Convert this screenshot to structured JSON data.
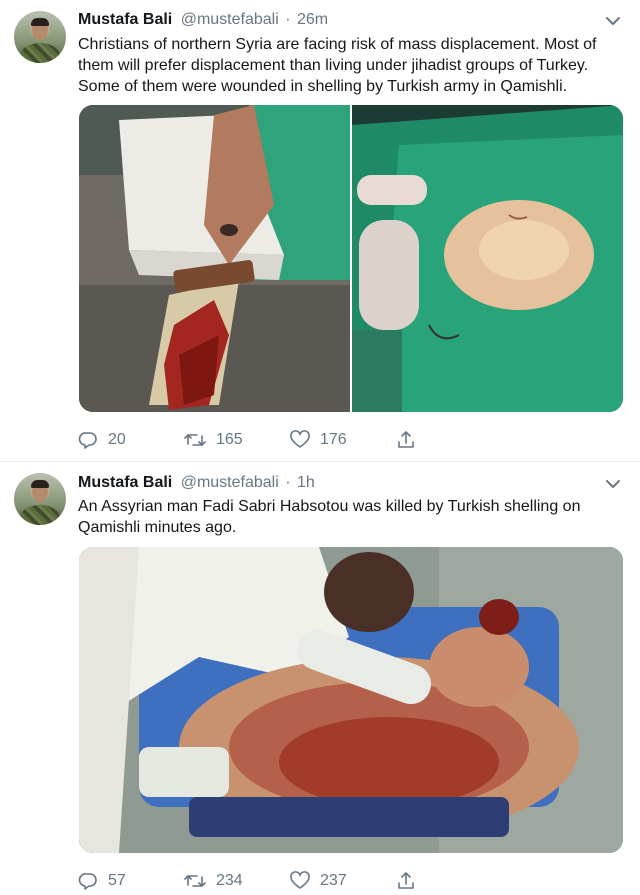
{
  "colors": {
    "text": "#14171a",
    "secondary": "#657786",
    "divider": "#e6ecf0"
  },
  "tweets": [
    {
      "author": {
        "name": "Mustafa Bali",
        "handle": "@mustefabali"
      },
      "separator": "·",
      "time": "26m",
      "lines": [
        "Christians of northern Syria are facing risk of mass displacement. Most of",
        "them will prefer displacement than living under jihadist groups of Turkey.",
        "Some of them were wounded in shelling by Turkish army in Qamishli."
      ],
      "media": {
        "kind": "photo-pair",
        "photos": [
          "wounded-arm-photo",
          "surgery-photo"
        ]
      },
      "stats": {
        "replies": "20",
        "retweets": "165",
        "likes": "176"
      }
    },
    {
      "author": {
        "name": "Mustafa Bali",
        "handle": "@mustefabali"
      },
      "separator": "·",
      "time": "1h",
      "lines": [
        "An Assyrian man Fadi Sabri Habsotou was killed by Turkish shelling on",
        "Qamishli minutes ago."
      ],
      "media": {
        "kind": "single-photo",
        "photos": [
          "victim-photo"
        ]
      },
      "stats": {
        "replies": "57",
        "retweets": "234",
        "likes": "237"
      }
    }
  ]
}
